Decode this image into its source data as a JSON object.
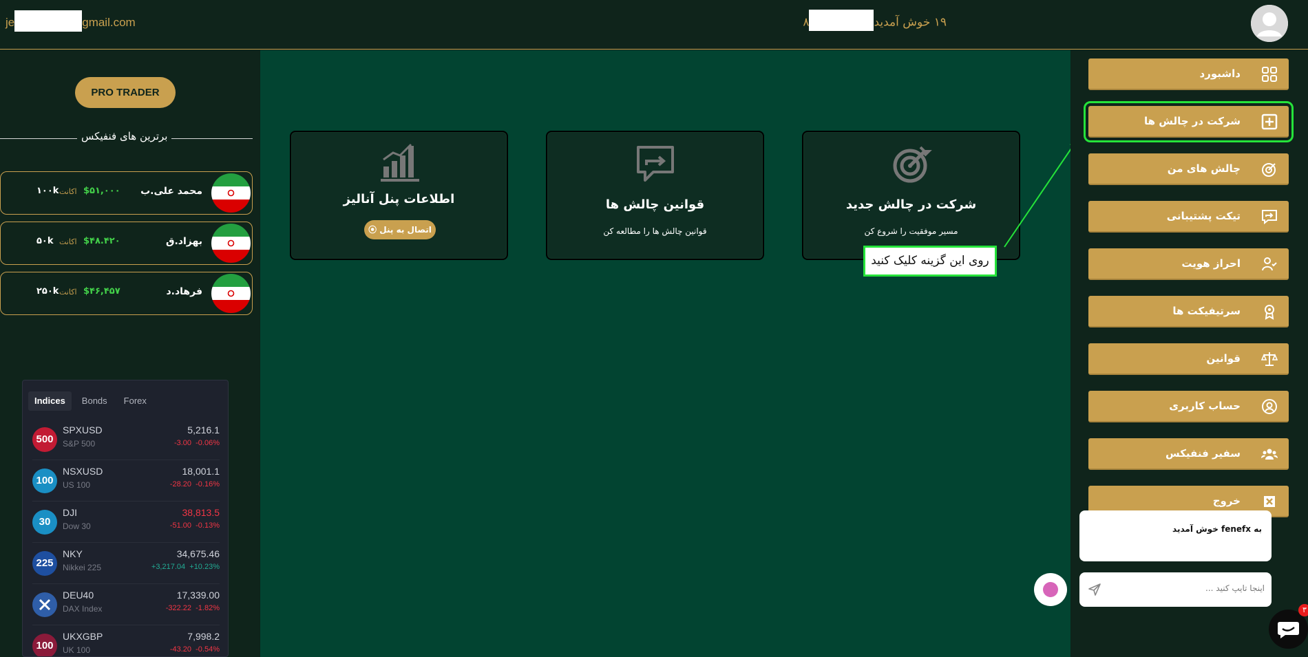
{
  "header": {
    "email_prefix": "je",
    "email_suffix": "gmail.com",
    "welcome_prefix": "۸",
    "welcome_suffix": "۱۹ خوش آمدید"
  },
  "left": {
    "pro_button": "PRO TRADER",
    "top_title": "برترین های فنفیکس",
    "traders": [
      {
        "name": "محمد علی.ب",
        "profit": "$۵۱,۰۰۰",
        "account_label": "اکانت",
        "size": "۱۰۰k"
      },
      {
        "name": "بهزاد.ق",
        "profit": "$۴۸.۴۲۰",
        "account_label": "اکانت",
        "size": "۵۰k"
      },
      {
        "name": "فرهاد.د",
        "profit": "$۴۶,۴۵۷",
        "account_label": "اکانت",
        "size": "۲۵۰k"
      }
    ]
  },
  "ticker": {
    "tabs": [
      "Indices",
      "Bonds",
      "Forex"
    ],
    "rows": [
      {
        "badge": "500",
        "symbol": "SPXUSD",
        "name": "S&P 500",
        "price": "5,216.1",
        "change": "-3.00",
        "change_pct": "-0.06%",
        "color": "#c21b34"
      },
      {
        "badge": "100",
        "symbol": "NSXUSD",
        "name": "US 100",
        "price": "18,001.1",
        "change": "-28.20",
        "change_pct": "-0.16%",
        "color": "#1a8fc4"
      },
      {
        "badge": "30",
        "symbol": "DJI",
        "name": "Dow 30",
        "price": "38,813.5",
        "change": "-51.00",
        "change_pct": "-0.13%",
        "color": "#1a8fc4"
      },
      {
        "badge": "225",
        "symbol": "NKY",
        "name": "Nikkei 225",
        "price": "34,675.46",
        "change": "+3,217.04",
        "change_pct": "+10.23%",
        "color": "#1e4fa0"
      },
      {
        "badge": "",
        "symbol": "DEU40",
        "name": "DAX Index",
        "price": "17,339.00",
        "change": "-322.22",
        "change_pct": "-1.82%",
        "color": "#2f5ea8"
      },
      {
        "badge": "100",
        "symbol": "UKXGBP",
        "name": "UK 100",
        "price": "7,998.2",
        "change": "-43.20",
        "change_pct": "-0.54%",
        "color": "#8b1a3a"
      }
    ]
  },
  "cards": [
    {
      "title": "شرکت در چالش جدید",
      "desc": "مسیر موفقیت را شروع کن",
      "icon": "target-icon"
    },
    {
      "title": "قوانین چالش ها",
      "desc": "قوانین چالش ها را مطالعه کن",
      "icon": "chat-arrow-icon"
    },
    {
      "title": "اطلاعات پنل آنالیز",
      "button": "اتصال به پنل",
      "icon": "chart-icon"
    }
  ],
  "annotation": "روی این گزینه کلیک کنید",
  "nav": [
    {
      "label": "داشبورد",
      "icon": "dashboard-icon"
    },
    {
      "label": "شرکت در چالش ها",
      "icon": "plus-square-icon"
    },
    {
      "label": "چالش های من",
      "icon": "target-icon"
    },
    {
      "label": "تیکت پشتیبانی",
      "icon": "chat-icon"
    },
    {
      "label": "احراز هویت",
      "icon": "user-check-icon"
    },
    {
      "label": "سرتیفیکت ها",
      "icon": "award-icon"
    },
    {
      "label": "قوانین",
      "icon": "scale-icon"
    },
    {
      "label": "حساب کاربری",
      "icon": "user-circle-icon"
    },
    {
      "label": "سفیر فنفیکس",
      "icon": "users-icon"
    },
    {
      "label": "خروج",
      "icon": "close-box-icon"
    }
  ],
  "chat": {
    "welcome": "به fenefx خوش آمدید",
    "placeholder": "اینجا تایپ کنید ...",
    "badge_count": "۳"
  },
  "colors": {
    "gold": "#c9a04f",
    "main_bg": "#024431",
    "sidebar_bg": "#0f241b",
    "highlight": "#25e33a"
  }
}
